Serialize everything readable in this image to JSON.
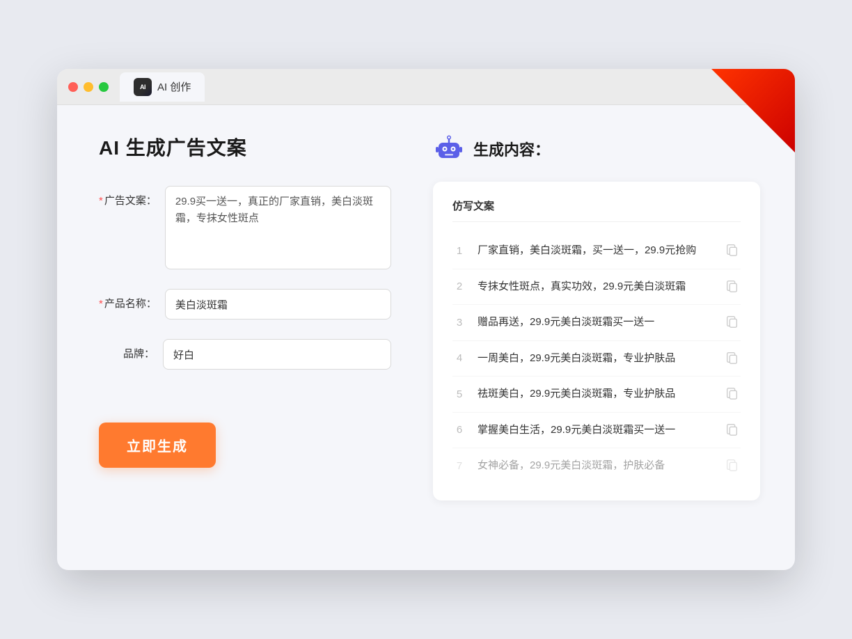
{
  "tab": {
    "label": "AI 创作"
  },
  "page": {
    "title": "AI 生成广告文案",
    "generated_label": "生成内容："
  },
  "form": {
    "ad_copy_label": "广告文案：",
    "ad_copy_value": "29.9买一送一，真正的厂家直销，美白淡斑霜，专抹女性斑点",
    "product_name_label": "产品名称：",
    "product_name_value": "美白淡斑霜",
    "brand_label": "品牌：",
    "brand_value": "好白",
    "generate_button": "立即生成",
    "required_mark": "*"
  },
  "results": {
    "header": "仿写文案",
    "items": [
      {
        "num": "1",
        "text": "厂家直销，美白淡斑霜，买一送一，29.9元抢购"
      },
      {
        "num": "2",
        "text": "专抹女性斑点，真实功效，29.9元美白淡斑霜"
      },
      {
        "num": "3",
        "text": "赠品再送，29.9元美白淡斑霜买一送一"
      },
      {
        "num": "4",
        "text": "一周美白，29.9元美白淡斑霜，专业护肤品"
      },
      {
        "num": "5",
        "text": "祛斑美白，29.9元美白淡斑霜，专业护肤品"
      },
      {
        "num": "6",
        "text": "掌握美白生活，29.9元美白淡斑霜买一送一"
      },
      {
        "num": "7",
        "text": "女神必备，29.9元美白淡斑霜，护肤必备"
      }
    ]
  }
}
